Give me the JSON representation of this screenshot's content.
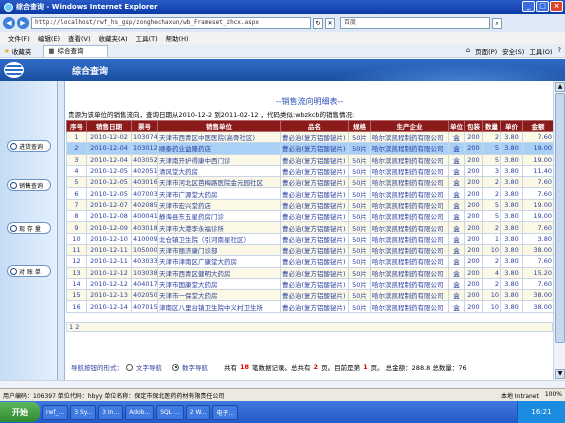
{
  "window": {
    "title": "综合查询 - Windows Internet Explorer"
  },
  "address": {
    "url": "http://localhost/rwf_hs_gsp/zonghechaxun/wb_Frameset_zhcx.aspx",
    "search_placeholder": "百度"
  },
  "menu": [
    "文件(F)",
    "编辑(E)",
    "查看(V)",
    "收藏夹(A)",
    "工具(T)",
    "帮助(H)"
  ],
  "favbar": {
    "favorites": "收藏夹",
    "tab": "综合查询",
    "tools": [
      "页面(P)",
      "安全(S)",
      "工具(O)",
      "?"
    ]
  },
  "app": {
    "title": "综合查询"
  },
  "leftnav": [
    "进货查询",
    "销售查询",
    "现 存 量",
    "对 账 单"
  ],
  "report": {
    "title": "--销售流向明细表--",
    "subtitle": "贵源为该单位的销售流向，查询日期从2010-12-2 到2011-02-12 ，代码类似:wbzkcb的销售情况:",
    "headers": [
      "序号",
      "销售日期",
      "票号",
      "销售单位",
      "品名",
      "规格",
      "生产企业",
      "单位",
      "包装",
      "数量",
      "单价",
      "金额"
    ],
    "rows": [
      [
        "1",
        "2010-12-02",
        "103074",
        "天津市西青区中医医院(高骨社区)",
        "曹必治(复方铝酸铋片)",
        "50片",
        "哈尔滨凯程制药有限公司",
        "盒",
        "200",
        "2",
        "3.80",
        "7.60"
      ],
      [
        "2",
        "2010-12-04",
        "103012",
        "顺泰药业益隆药店",
        "曹必治(复方铝酸铋片)",
        "50片",
        "哈尔滨凯程制药有限公司",
        "盒",
        "200",
        "5",
        "3.80",
        "19.00"
      ],
      [
        "3",
        "2010-12-04",
        "403052",
        "天津南开护得康中西门诊",
        "曹必治(复方铝酸铋片)",
        "50片",
        "哈尔滨凯程制药有限公司",
        "盒",
        "200",
        "5",
        "3.80",
        "19.00"
      ],
      [
        "4",
        "2010-12-05",
        "402051",
        "清风堂大药房",
        "曹必治(复方铝酸铋片)",
        "50片",
        "哈尔滨凯程制药有限公司",
        "盒",
        "200",
        "3",
        "3.80",
        "11.40"
      ],
      [
        "5",
        "2010-12-05",
        "403016",
        "天津市河北区芭梅路医院金元园社区",
        "曹必治(复方铝酸铋片)",
        "50片",
        "哈尔滨凯程制药有限公司",
        "盒",
        "200",
        "2",
        "3.80",
        "7.60"
      ],
      [
        "6",
        "2010-12-05",
        "407003",
        "天津市广源堂大药房",
        "曹必治(复方铝酸铋片)",
        "50片",
        "哈尔滨凯程制药有限公司",
        "盒",
        "200",
        "2",
        "3.80",
        "7.60"
      ],
      [
        "7",
        "2010-12-07",
        "402085",
        "天津市宏兴堂药店",
        "曹必治(复方铝酸铋片)",
        "50片",
        "哈尔滨凯程制药有限公司",
        "盒",
        "200",
        "5",
        "3.80",
        "19.00"
      ],
      [
        "8",
        "2010-12-08",
        "400041",
        "静海县东五星药房门诊",
        "曹必治(复方铝酸铋片)",
        "50片",
        "哈尔滨凯程制药有限公司",
        "盒",
        "200",
        "5",
        "3.80",
        "19.00"
      ],
      [
        "9",
        "2010-12-09",
        "403018",
        "天津市大港李永福诊所",
        "曹必治(复方铝酸铋片)",
        "50片",
        "哈尔滨凯程制药有限公司",
        "盒",
        "200",
        "2",
        "3.80",
        "7.60"
      ],
      [
        "10",
        "2010-12-10",
        "410009",
        "北仓镇卫生院（引河南星社区）",
        "曹必治(复方铝酸铋片)",
        "50片",
        "哈尔滨凯程制药有限公司",
        "盒",
        "200",
        "1",
        "3.80",
        "3.80"
      ],
      [
        "11",
        "2010-12-11",
        "105000",
        "天津市丽济康门诊部",
        "曹必治(复方铝酸铋片)",
        "50片",
        "哈尔滨凯程制药有限公司",
        "盒",
        "200",
        "10",
        "3.80",
        "38.00"
      ],
      [
        "12",
        "2010-12-11",
        "403033",
        "天津市津南区广康堂大药房",
        "曹必治(复方铝酸铋片)",
        "50片",
        "哈尔滨凯程制药有限公司",
        "盒",
        "200",
        "2",
        "3.80",
        "7.60"
      ],
      [
        "13",
        "2010-12-12",
        "103038",
        "天津市西青区健明大药房",
        "曹必治(复方铝酸铋片)",
        "50片",
        "哈尔滨凯程制药有限公司",
        "盒",
        "200",
        "4",
        "3.80",
        "15.20"
      ],
      [
        "14",
        "2010-12-12",
        "404017",
        "天津市国康堂大药房",
        "曹必治(复方铝酸铋片)",
        "50片",
        "哈尔滨凯程制药有限公司",
        "盒",
        "200",
        "2",
        "3.80",
        "7.60"
      ],
      [
        "15",
        "2010-12-13",
        "402050",
        "天津市一保堂大药房",
        "曹必治(复方铝酸铋片)",
        "50片",
        "哈尔滨凯程制药有限公司",
        "盒",
        "200",
        "10",
        "3.80",
        "38.00"
      ],
      [
        "16",
        "2010-12-14",
        "407015",
        "津南区八里台镇卫生院中义村卫生所",
        "曹必治(复方铝酸铋片)",
        "50片",
        "哈尔滨凯程制药有限公司",
        "盒",
        "200",
        "10",
        "3.80",
        "38.00"
      ]
    ],
    "pager": "1 2"
  },
  "summary": {
    "label": "导航按钮的形式：",
    "opt1": "文字导航",
    "opt2": "数字导航",
    "t1": "共有",
    "records": "18",
    "t2": "笔数据记录。总共有",
    "pages": "2",
    "t3": "页。目前是第",
    "current": "1",
    "t4": "页。 总金额：288.8 总数量：76"
  },
  "status": {
    "left": "用户编码：106397  单位代码：hbyy  单位名称：保定市保北医药药材有限责任公司",
    "zone": "本地 Intranet",
    "zoom": "100%"
  },
  "taskbar": {
    "start": "开始",
    "tasks": [
      "rwf_...",
      "3 Sy...",
      "3 In...",
      "Adob...",
      "SQL ...",
      "2 W...",
      "电子..."
    ],
    "clock": "16:21"
  }
}
